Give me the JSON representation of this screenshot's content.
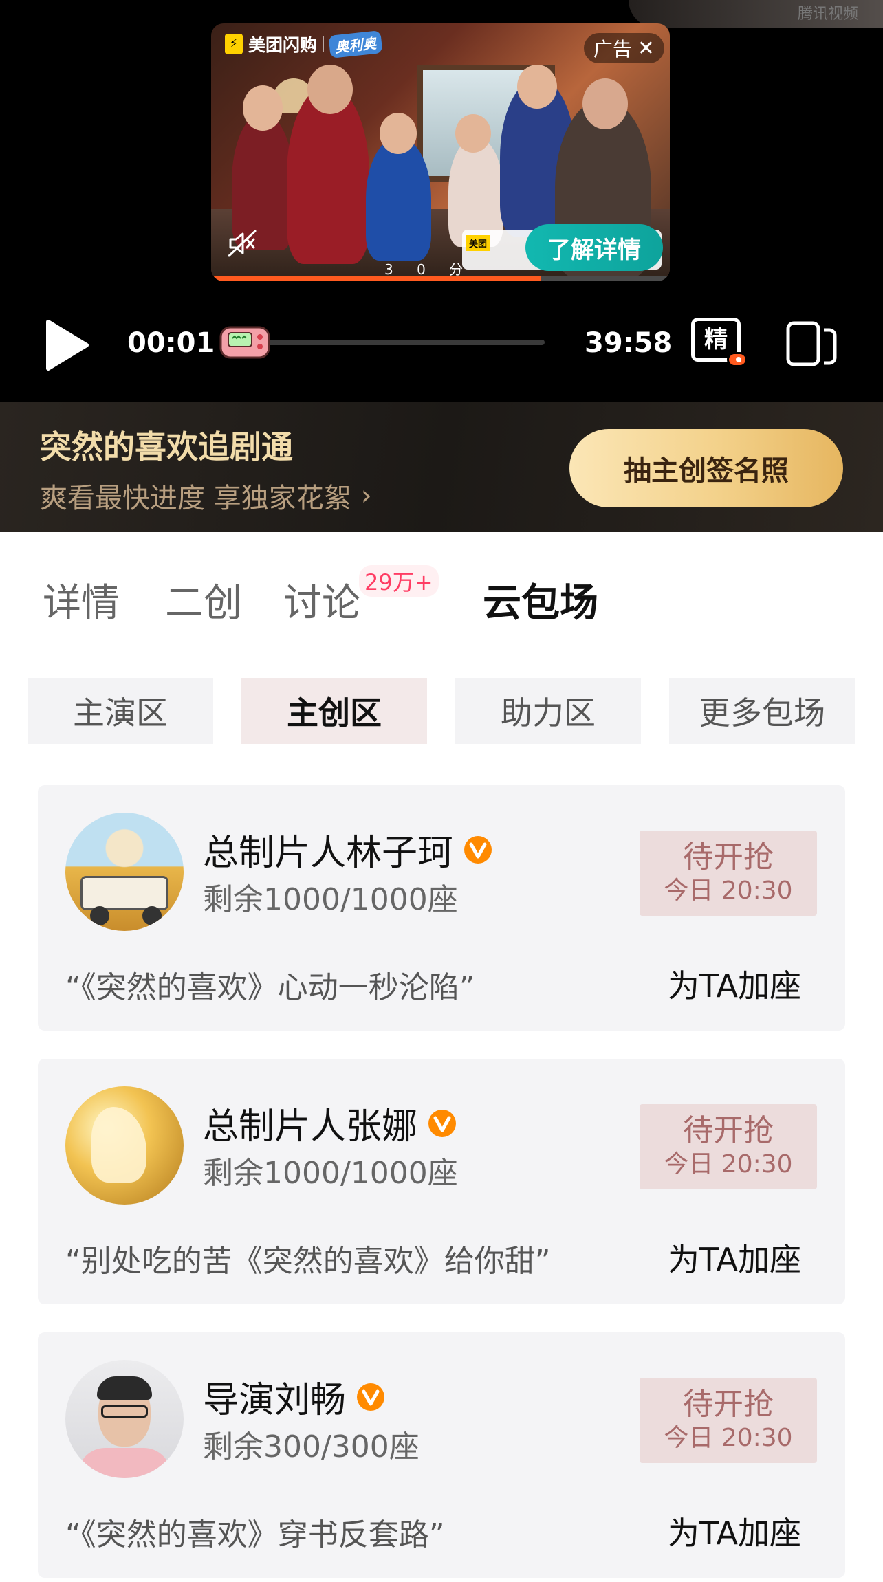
{
  "player": {
    "watermark": "腾讯视频",
    "ad": {
      "brand": "美团闪购",
      "label": "奥利奥",
      "close_text": "广告",
      "cta": "了解详情",
      "cta_bar_logo": "美团",
      "score_text": "3 0 分",
      "progress": 0.72
    },
    "current_time": "00:01",
    "total_time": "39:58",
    "progress": 0.0,
    "quality_label": "精"
  },
  "vip": {
    "title": "突然的喜欢追剧通",
    "subtitle": "爽看最快进度 享独家花絮",
    "button": "抽主创签名照"
  },
  "tabs": [
    {
      "label": "详情"
    },
    {
      "label": "二创"
    },
    {
      "label": "讨论",
      "badge": "29万+"
    },
    {
      "label": "云包场",
      "active": true
    }
  ],
  "subtabs": [
    {
      "label": "主演区"
    },
    {
      "label": "主创区",
      "active": true
    },
    {
      "label": "助力区"
    },
    {
      "label": "更多包场"
    }
  ],
  "cards": [
    {
      "name": "总制片人林子珂",
      "seats": "剩余1000/1000座",
      "status": "待开抢",
      "time": "今日 20:30",
      "quote": "“《突然的喜欢》心动一秒沦陷”",
      "action": "为TA加座"
    },
    {
      "name": "总制片人张娜",
      "seats": "剩余1000/1000座",
      "status": "待开抢",
      "time": "今日 20:30",
      "quote": "“别处吃的苦《突然的喜欢》给你甜”",
      "action": "为TA加座"
    },
    {
      "name": "导演刘畅",
      "seats": "剩余300/300座",
      "status": "待开抢",
      "time": "今日 20:30",
      "quote": "“《突然的喜欢》穿书反套路”",
      "action": "为TA加座"
    }
  ],
  "colors": {
    "accent_gold": "#f3d18a",
    "ad_cta": "#12b8b0",
    "badge_red": "#ff3d64",
    "verified_orange": "#ff8a00",
    "grab_text": "#a86a6a"
  }
}
